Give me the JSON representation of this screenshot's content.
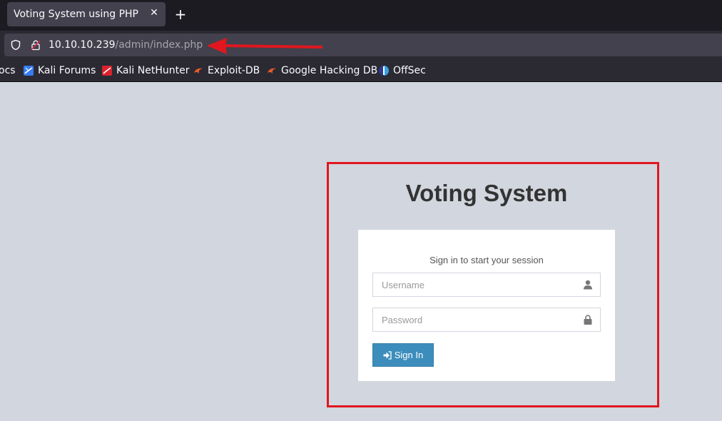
{
  "browser": {
    "tab": {
      "title": "Voting System using PHP",
      "close_icon": "close-icon"
    },
    "new_tab_label": "+",
    "url": {
      "host": "10.10.10.239",
      "path": "/admin/index.php"
    },
    "bookmarks": [
      {
        "label": "ocs",
        "icon": "none"
      },
      {
        "label": "Kali Forums",
        "icon": "kali-forums-icon"
      },
      {
        "label": "Kali NetHunter",
        "icon": "kali-nethunter-icon"
      },
      {
        "label": "Exploit-DB",
        "icon": "exploit-db-icon"
      },
      {
        "label": "Google Hacking DB",
        "icon": "exploit-db-icon"
      },
      {
        "label": "OffSec",
        "icon": "offsec-icon"
      }
    ]
  },
  "annotations": {
    "arrow_color": "#e0171f",
    "box_color": "#e0171f"
  },
  "login": {
    "logo": "Voting System",
    "message": "Sign in to start your session",
    "username_placeholder": "Username",
    "password_placeholder": "Password",
    "signin_label": "Sign In",
    "button_color": "#3c8dbc",
    "background_color": "#d2d6de"
  }
}
